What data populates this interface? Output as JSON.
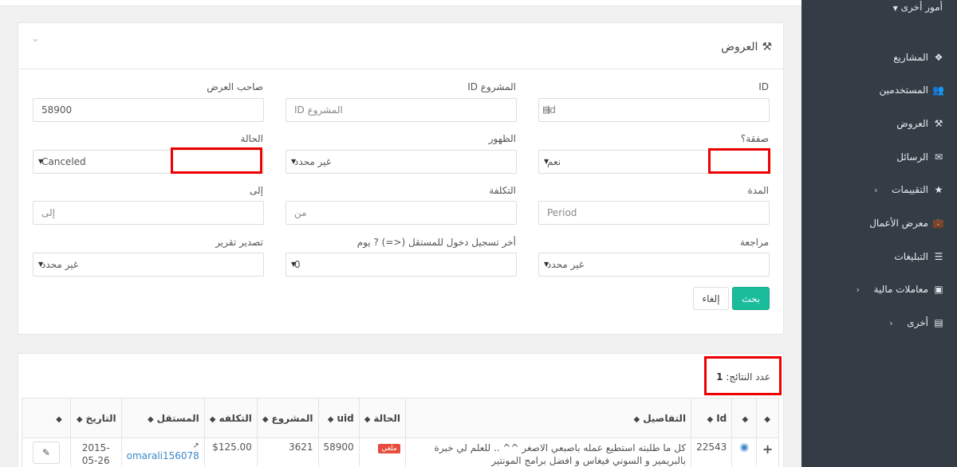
{
  "sidebar": {
    "top_item": "أمور أخرى",
    "items": [
      {
        "label": "المشاريع",
        "icon": "cubes-icon"
      },
      {
        "label": "المستخدمين",
        "icon": "users-icon"
      },
      {
        "label": "العروض",
        "icon": "gavel-icon"
      },
      {
        "label": "الرسائل",
        "icon": "envelope-icon"
      },
      {
        "label": "التقييمات",
        "icon": "star-icon"
      },
      {
        "label": "معرض الأعمال",
        "icon": "briefcase-icon"
      },
      {
        "label": "التبليغات",
        "icon": "list-icon"
      },
      {
        "label": "معاملات مالية",
        "icon": "money-icon"
      },
      {
        "label": "أخرى",
        "icon": "building-icon"
      }
    ]
  },
  "filters": {
    "title": "العروض",
    "id_label": "ID",
    "id_placeholder": "id",
    "project_id_label": "المشروع ID",
    "project_id_placeholder": "المشروع ID",
    "owner_label": "صاحب العرض",
    "owner_value": "58900",
    "deal_label": "صفقة؟",
    "deal_value": "نعم",
    "visibility_label": "الظهور",
    "visibility_value": "غير محدد",
    "status_label": "الحالة",
    "status_value": "Canceled",
    "duration_label": "المدة",
    "duration_placeholder": "Period",
    "cost_label": "التكلفة",
    "cost_placeholder": "من",
    "to_label": "إلى",
    "to_placeholder": "إلى",
    "review_label": "مراجعة",
    "review_value": "غير محدد",
    "last_login_label": "أخر تسجيل دخول للمستقل (<=) ? يوم",
    "last_login_value": "0",
    "export_label": "تصدير تقرير",
    "export_value": "غير محدد",
    "search_button": "بحث",
    "cancel_button": "إلغاء"
  },
  "results": {
    "count_label": "عدد النتائج:",
    "count_value": "1",
    "columns": [
      "Id",
      "التفاصيل",
      "الحالة",
      "uid",
      "المشروع",
      "التكلفه",
      "المستقل",
      "التاريخ"
    ],
    "rows": [
      {
        "id": "22543",
        "details": "كل ما طلبته استطيع عمله باصبعي الاصغر ^^ .. للعلم لي خبرة بالبريمير و السوني فيغاس و افضل برامج المونتير",
        "status": "ملغي",
        "uid": "58900",
        "project": "3621",
        "cost": "$125.00",
        "freelancer": "omarali156078",
        "date": "2015-05-26"
      }
    ]
  }
}
